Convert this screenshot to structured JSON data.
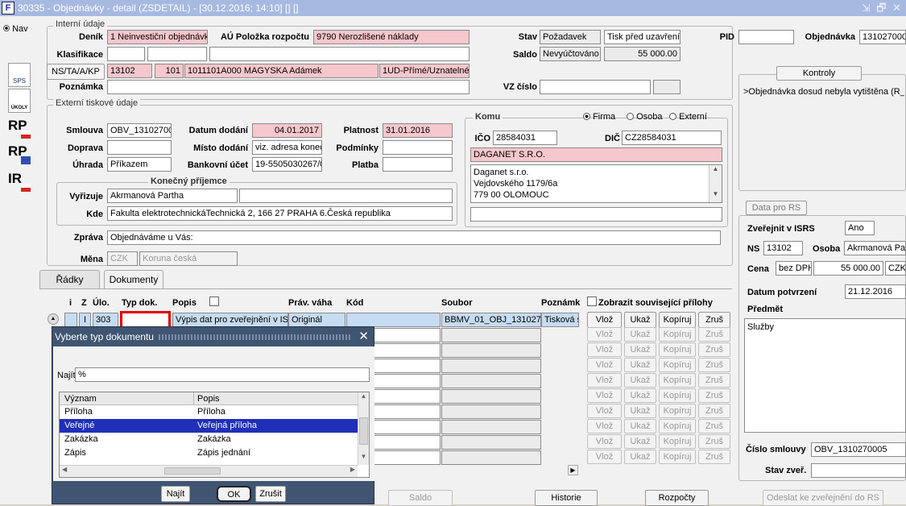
{
  "window": {
    "title": "30335 - Objednávky - detail (ZSDETAIL) - [30.12.2016; 14:10] [] []",
    "icon": "F",
    "controls": "⇲ 🗗 ✕"
  },
  "nav": {
    "radio": "Nav",
    "buttons": [
      "SPS",
      "ÚKOLY",
      "RP",
      "RP",
      "IR"
    ]
  },
  "internal": {
    "legend": "Interní údaje",
    "denik_label": "Deník",
    "denik_value": "1 Neinvestiční objednávk",
    "au_label": "AÚ Položka rozpočtu",
    "au_value": "9790 Nerozlišené náklady",
    "stav_label": "Stav",
    "stav_value": "Požadavek",
    "stav_value2": "Tisk před uzavření",
    "pid_label": "PID",
    "pid_value": "",
    "obj_label": "Objednávka",
    "obj_value": "131027000",
    "klas_label": "Klasifikace",
    "saldo_label": "Saldo",
    "saldo_value": "Nevyúčtováno",
    "saldo_amount": "55 000.00",
    "ns_label": "NS/TA/A/KP",
    "ns_value": "13102",
    "ta_value": "101",
    "kp_value": "1011101A000 MAGYSKA Adámek",
    "kp_value2": "1UD-Přímé/Uznatelné/I",
    "pozn_label": "Poznámka",
    "vz_label": "VZ číslo"
  },
  "external": {
    "legend": "Externí tiskové údaje",
    "smlouva_label": "Smlouva",
    "smlouva_value": "OBV_13102700",
    "datum_label": "Datum dodání",
    "datum_value": "04.01.2017",
    "platnost_label": "Platnost",
    "platnost_value": "31.01.2016",
    "doprava_label": "Doprava",
    "misto_label": "Místo dodání",
    "misto_value": "viz. adresa konec",
    "podminky_label": "Podmínky",
    "uhrada_label": "Úhrada",
    "uhrada_value": "Příkazem",
    "bank_label": "Bankovní účet",
    "bank_value": "19-5505030267/0",
    "platba_label": "Platba",
    "konecny_legend": "Konečný příjemce",
    "vyrizuje_label": "Vyřizuje",
    "vyrizuje_value": "Akrmanová Partha",
    "kde_label": "Kde",
    "kde_value": "Fakulta elektrotechnickáTechnická 2, 166 27 PRAHA 6.Česká republika",
    "zprava_label": "Zpráva",
    "zprava_value": "Objednáváme u Vás:",
    "mena_label": "Měna",
    "mena_code": "CZK",
    "mena_name": "Koruna česká"
  },
  "komu": {
    "legend": "Komu",
    "radio_firma": "Firma",
    "radio_osoba": "Osoba",
    "radio_externi": "Externí",
    "ico_label": "IČO",
    "ico_value": "28584031",
    "dic_label": "DIČ",
    "dic_value": "CZ28584031",
    "name_value": "DAGANET S.R.O.",
    "address": [
      "Daganet s.r.o.",
      "Vejdovského 1179/6a",
      "779 00  OLOMOUC"
    ]
  },
  "kontroly": {
    "legend": "Kontroly",
    "text": ">Objednávka dosud nebyla vytištěna (R_"
  },
  "rs": {
    "legend": "Data pro RS",
    "zverejnit_label": "Zveřejnit v ISRS",
    "zverejnit_value": "Ano",
    "ns_label": "NS",
    "ns_value": "13102",
    "osoba_label": "Osoba",
    "osoba_value": "Akrmanová Par",
    "cena_label": "Cena",
    "cena_type": "bez DPH",
    "cena_value": "55 000.00",
    "cena_cur": "CZK",
    "datum_label": "Datum potvrzení",
    "datum_value": "21.12.2016",
    "predmet_label": "Předmět",
    "predmet_value": "Služby",
    "smlouva_label": "Číslo smlouvy",
    "smlouva_value": "OBV_1310270005",
    "stav_label": "Stav zveř."
  },
  "tabs": [
    "Řádky",
    "Dokumenty"
  ],
  "grid": {
    "headers": {
      "i": "i",
      "z": "Z",
      "ulo": "Úlo.",
      "typ": "Typ dok.",
      "popis": "Popis",
      "prav": "Práv. váha",
      "kod": "Kód",
      "soubor": "Soubor",
      "pozn": "Poznámk"
    },
    "show_related": "Zobrazit související přílohy",
    "row1": {
      "z": "I",
      "ulo": "303",
      "typ": "",
      "popis": "Výpis dat pro zveřejnění v IS",
      "prav": "Originál",
      "kod": "",
      "soubor": "BBMV_01_OBJ_1310270",
      "pozn": "Tisková s"
    },
    "row_buttons": [
      "Vlož",
      "Ukaž",
      "Kopíruj",
      "Zruš"
    ]
  },
  "bottom_buttons": [
    "Saldo",
    "Historie",
    "Rozpočty",
    "Odeslat ke zveřejnění do RS"
  ],
  "dialog": {
    "title": "Vyberte typ dokumentu",
    "find_label": "Najít",
    "find_value": "%",
    "col_meaning": "Význam",
    "col_desc": "Popis",
    "rows": [
      {
        "meaning": "Příloha",
        "desc": "Příloha"
      },
      {
        "meaning": "Veřejné",
        "desc": "Veřejná příloha"
      },
      {
        "meaning": "Zakázka",
        "desc": "Zakázka"
      },
      {
        "meaning": "Zápis",
        "desc": "Zápis jednání"
      }
    ],
    "btn_find": "Najít",
    "btn_ok": "OK",
    "btn_cancel": "Zrušit"
  }
}
